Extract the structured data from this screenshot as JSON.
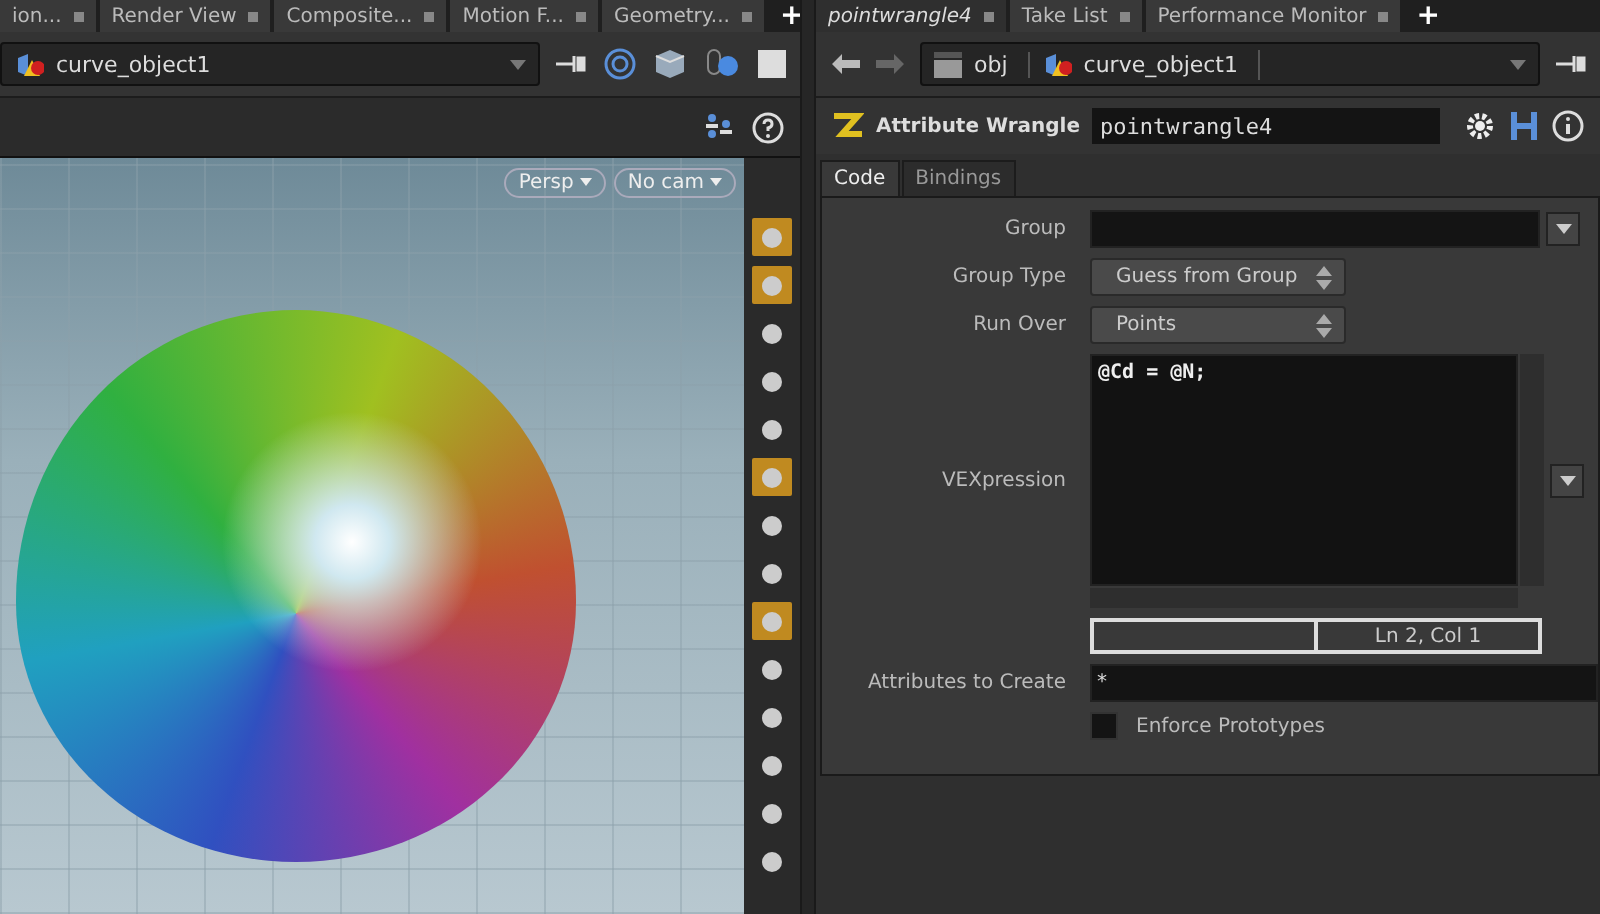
{
  "left_pane": {
    "tabs": [
      {
        "label": "ion...",
        "selected": false
      },
      {
        "label": "Render View",
        "selected": false
      },
      {
        "label": "Composite...",
        "selected": false
      },
      {
        "label": "Motion F...",
        "selected": false
      },
      {
        "label": "Geometry...",
        "selected": false
      }
    ],
    "add_tab": "+",
    "path": {
      "node": "curve_object1"
    },
    "viewport": {
      "view_menu": "Persp",
      "camera_menu": "No cam"
    },
    "display_tools": [
      {
        "on": true
      },
      {
        "on": true
      },
      {
        "on": false
      },
      {
        "on": false
      },
      {
        "on": false
      },
      {
        "on": true
      },
      {
        "on": false
      },
      {
        "on": false
      },
      {
        "on": true
      },
      {
        "on": false
      },
      {
        "on": false
      },
      {
        "on": false
      },
      {
        "on": false
      },
      {
        "on": false
      }
    ]
  },
  "right_pane": {
    "tabs": [
      {
        "label": "pointwrangle4",
        "selected": true
      },
      {
        "label": "Take List",
        "selected": false
      },
      {
        "label": "Performance Monitor",
        "selected": false
      }
    ],
    "add_tab": "+",
    "path": [
      "obj",
      "curve_object1"
    ],
    "node_type": "Attribute Wrangle",
    "node_name": "pointwrangle4",
    "param_tabs": [
      {
        "label": "Code",
        "selected": true
      },
      {
        "label": "Bindings",
        "selected": false
      }
    ],
    "params": {
      "group_label": "Group",
      "group_type_label": "Group Type",
      "group_type": "Guess from Group",
      "run_over_label": "Run Over",
      "run_over": "Points",
      "vex_label": "VEXpression",
      "vex_code": "@Cd = @N;",
      "status_text": "Ln 2, Col 1",
      "attrs_label": "Attributes to Create",
      "attrs_value": "*",
      "enforce_label": "Enforce Prototypes",
      "enforce_checked": false
    }
  }
}
